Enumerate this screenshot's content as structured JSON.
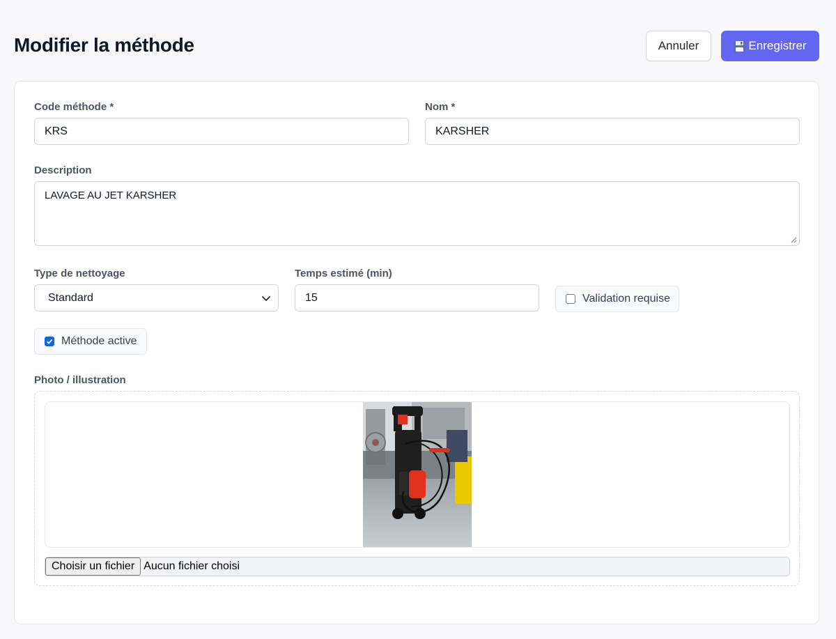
{
  "header": {
    "title": "Modifier la méthode",
    "cancel_label": "Annuler",
    "save_label": "Enregistrer"
  },
  "form": {
    "code": {
      "label": "Code méthode *",
      "value": "KRS"
    },
    "name": {
      "label": "Nom *",
      "value": "KARSHER"
    },
    "description": {
      "label": "Description",
      "value": "LAVAGE AU JET KARSHER"
    },
    "cleaning_type": {
      "label": "Type de nettoyage",
      "value": "Standard"
    },
    "estimated_time": {
      "label": "Temps estimé (min)",
      "value": "15"
    },
    "validation_required": {
      "label": "Validation requise",
      "checked": false
    },
    "active": {
      "label": "Méthode active",
      "checked": true
    },
    "photo": {
      "label": "Photo / illustration",
      "choose_button": "Choisir un fichier",
      "file_status": "Aucun fichier choisi"
    }
  },
  "colors": {
    "accent": "#6366f1",
    "checkbox_checked": "#0a66e4",
    "photo_device": "#e0301e"
  },
  "icons": {
    "save": "floppy-disk-icon",
    "select": "chevron-down-icon",
    "resize": "resize-handle-icon",
    "checkbox": "check-icon"
  }
}
